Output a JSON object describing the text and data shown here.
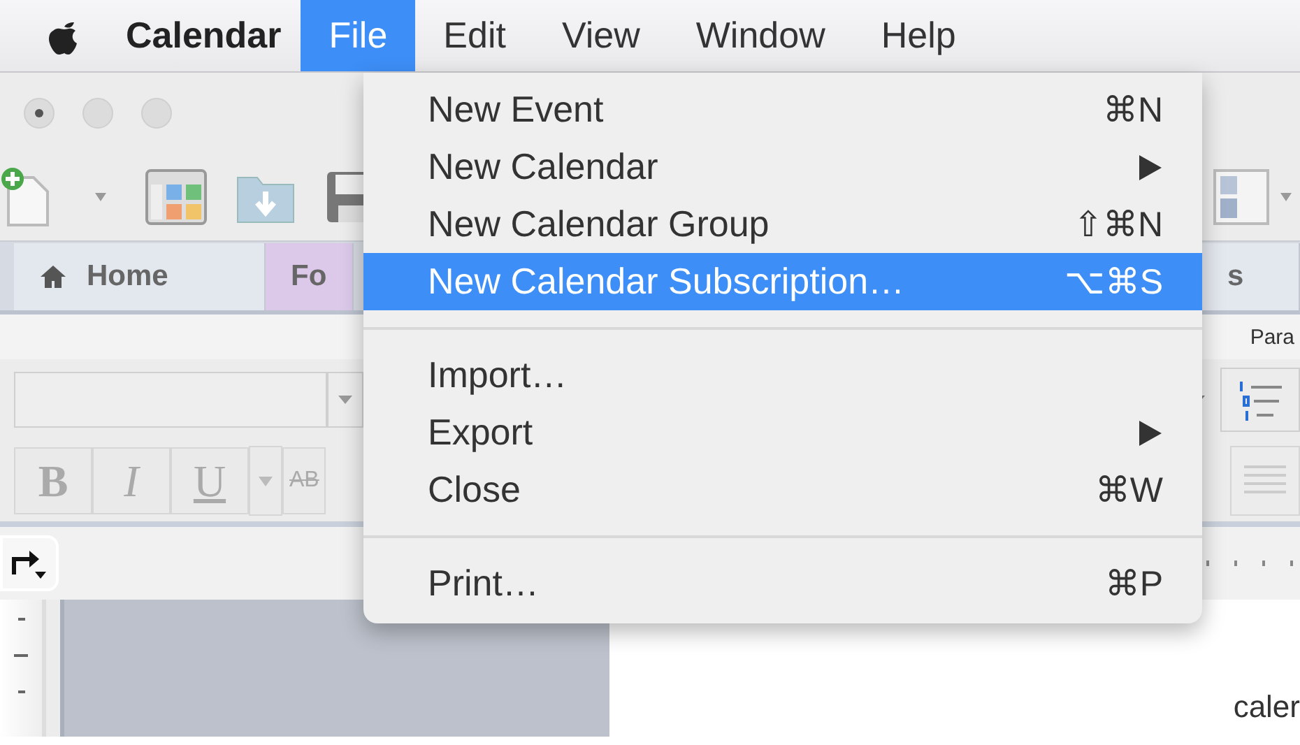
{
  "menubar": {
    "app_name": "Calendar",
    "menus": [
      {
        "label": "File",
        "selected": true
      },
      {
        "label": "Edit",
        "selected": false
      },
      {
        "label": "View",
        "selected": false
      },
      {
        "label": "Window",
        "selected": false
      },
      {
        "label": "Help",
        "selected": false
      }
    ]
  },
  "file_menu": {
    "sections": [
      [
        {
          "label": "New Event",
          "shortcut": "⌘N",
          "submenu": false,
          "selected": false
        },
        {
          "label": "New Calendar",
          "submenu": true,
          "selected": false
        },
        {
          "label": "New Calendar Group",
          "shortcut": "⇧⌘N",
          "submenu": false,
          "selected": false
        },
        {
          "label": "New Calendar Subscription…",
          "shortcut": "⌥⌘S",
          "submenu": false,
          "selected": true
        }
      ],
      [
        {
          "label": "Import…",
          "submenu": false,
          "selected": false
        },
        {
          "label": "Export",
          "submenu": true,
          "selected": false
        },
        {
          "label": "Close",
          "shortcut": "⌘W",
          "submenu": false,
          "selected": false
        }
      ],
      [
        {
          "label": "Print…",
          "shortcut": "⌘P",
          "submenu": false,
          "selected": false
        }
      ]
    ]
  },
  "background_window": {
    "ribbon_tabs": [
      {
        "label": "Home",
        "color": "#e3e7ee"
      },
      {
        "label": "Fo",
        "color": "#dcc9ea"
      },
      {
        "label": "s",
        "color": "#e3e7ee"
      }
    ],
    "group_label": "Para",
    "format_buttons": [
      {
        "label": "B",
        "kind": "bold"
      },
      {
        "label": "I",
        "kind": "italic"
      },
      {
        "label": "U",
        "kind": "underline"
      },
      {
        "label": "AB",
        "kind": "strike"
      }
    ],
    "document_text": "caler"
  }
}
